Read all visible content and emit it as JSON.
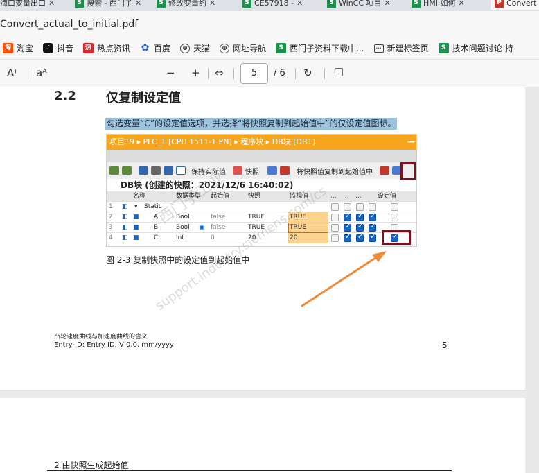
{
  "tabs": [
    {
      "label": "海口变量出口",
      "active": false
    },
    {
      "label": "搜索 - 西门子",
      "active": false
    },
    {
      "label": "修改变量约",
      "active": false
    },
    {
      "label": "CE57918 -",
      "active": false
    },
    {
      "label": "WinCC 项目",
      "active": false
    },
    {
      "label": "HMI 如何",
      "active": false
    },
    {
      "label": "Convert",
      "active": true
    }
  ],
  "title": "Convert_actual_to_initial.pdf",
  "favorites": [
    {
      "label": "淘宝",
      "icon": "taobao-icon"
    },
    {
      "label": "抖音",
      "icon": "douyin-icon"
    },
    {
      "label": "热点资讯",
      "icon": "news-icon"
    },
    {
      "label": "百度",
      "icon": "baidu-icon"
    },
    {
      "label": "天猫",
      "icon": "globe-icon"
    },
    {
      "label": "网址导航",
      "icon": "globe-icon"
    },
    {
      "label": "西门子资料下载中...",
      "icon": "siemens-icon"
    },
    {
      "label": "新建标签页",
      "icon": "newtab-icon"
    },
    {
      "label": "技术问题讨论-持",
      "icon": "siemens-icon"
    }
  ],
  "pdf_toolbar": {
    "read_aloud": "A⁾",
    "text_options": "aᴬ",
    "zoom_out": "−",
    "zoom_in": "+",
    "fit": "⇔",
    "page_current": "5",
    "page_total": "/ 6",
    "rotate": "↻",
    "view_mode": "❐"
  },
  "doc": {
    "section_num": "2.2",
    "section_title": "仅复制设定值",
    "highlight_text": "勾选变量“C”的设定值选项，并选择“将快照复制到起始值中”的仅设定值图标。",
    "caption": "图 2-3 复制快照中的设定值到起始值中",
    "footer_line1": "凸轮速度曲线与加速度曲线的含义",
    "footer_line2": "Entry-ID: Entry ID,    V 0.0,    mm/yyyy",
    "page_number": "5",
    "next_page_header": "2 由快照生成起始值"
  },
  "screenshot": {
    "breadcrumb": "项目19  ▸  PLC_1 [CPU 1511-1 PN]  ▸  程序块  ▸  DB块 [DB1]",
    "min_label": "—",
    "keep_actual": "保持实际值",
    "snapshot": "快照",
    "copy_to_start": "将快照值复制到起始值中",
    "db_title": "DB块 (创建的快照：2021/12/6 16:40:02)",
    "headers": [
      "名称",
      "数据类型",
      "起始值",
      "快照",
      "监视值",
      "...",
      "...",
      "...",
      "设定值"
    ],
    "rows": [
      {
        "num": "1",
        "name": "Static",
        "type": "",
        "start": "",
        "snap": "",
        "mon": ""
      },
      {
        "num": "2",
        "name": "A",
        "type": "Bool",
        "start": "false",
        "snap": "TRUE",
        "mon": "TRUE"
      },
      {
        "num": "3",
        "name": "B",
        "type": "Bool",
        "start": "false",
        "snap": "TRUE",
        "mon": "TRUE"
      },
      {
        "num": "4",
        "name": "C",
        "type": "Int",
        "start": "0",
        "snap": "20",
        "mon": "20"
      }
    ]
  },
  "watermark": "support.industry.siemens.com/cs",
  "watermark2": "西门子工业",
  "colors": {
    "tia_orange": "#f7a51c",
    "highlight": "#9dc3dc",
    "red_box": "#7a1020",
    "arrow": "#f08a3a",
    "checkbox_blue": "#1464c8"
  }
}
